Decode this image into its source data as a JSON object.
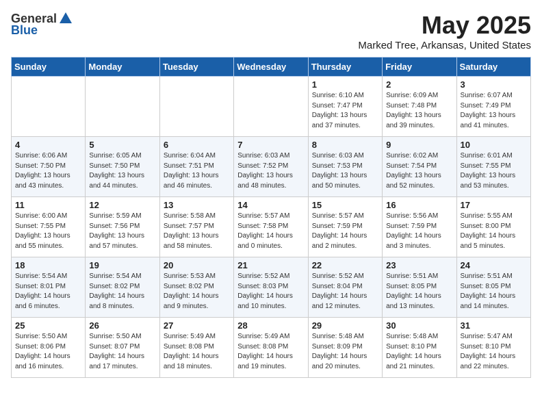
{
  "header": {
    "logo_general": "General",
    "logo_blue": "Blue",
    "month": "May 2025",
    "location": "Marked Tree, Arkansas, United States"
  },
  "weekdays": [
    "Sunday",
    "Monday",
    "Tuesday",
    "Wednesday",
    "Thursday",
    "Friday",
    "Saturday"
  ],
  "weeks": [
    [
      {
        "day": "",
        "info": ""
      },
      {
        "day": "",
        "info": ""
      },
      {
        "day": "",
        "info": ""
      },
      {
        "day": "",
        "info": ""
      },
      {
        "day": "1",
        "info": "Sunrise: 6:10 AM\nSunset: 7:47 PM\nDaylight: 13 hours\nand 37 minutes."
      },
      {
        "day": "2",
        "info": "Sunrise: 6:09 AM\nSunset: 7:48 PM\nDaylight: 13 hours\nand 39 minutes."
      },
      {
        "day": "3",
        "info": "Sunrise: 6:07 AM\nSunset: 7:49 PM\nDaylight: 13 hours\nand 41 minutes."
      }
    ],
    [
      {
        "day": "4",
        "info": "Sunrise: 6:06 AM\nSunset: 7:50 PM\nDaylight: 13 hours\nand 43 minutes."
      },
      {
        "day": "5",
        "info": "Sunrise: 6:05 AM\nSunset: 7:50 PM\nDaylight: 13 hours\nand 44 minutes."
      },
      {
        "day": "6",
        "info": "Sunrise: 6:04 AM\nSunset: 7:51 PM\nDaylight: 13 hours\nand 46 minutes."
      },
      {
        "day": "7",
        "info": "Sunrise: 6:03 AM\nSunset: 7:52 PM\nDaylight: 13 hours\nand 48 minutes."
      },
      {
        "day": "8",
        "info": "Sunrise: 6:03 AM\nSunset: 7:53 PM\nDaylight: 13 hours\nand 50 minutes."
      },
      {
        "day": "9",
        "info": "Sunrise: 6:02 AM\nSunset: 7:54 PM\nDaylight: 13 hours\nand 52 minutes."
      },
      {
        "day": "10",
        "info": "Sunrise: 6:01 AM\nSunset: 7:55 PM\nDaylight: 13 hours\nand 53 minutes."
      }
    ],
    [
      {
        "day": "11",
        "info": "Sunrise: 6:00 AM\nSunset: 7:55 PM\nDaylight: 13 hours\nand 55 minutes."
      },
      {
        "day": "12",
        "info": "Sunrise: 5:59 AM\nSunset: 7:56 PM\nDaylight: 13 hours\nand 57 minutes."
      },
      {
        "day": "13",
        "info": "Sunrise: 5:58 AM\nSunset: 7:57 PM\nDaylight: 13 hours\nand 58 minutes."
      },
      {
        "day": "14",
        "info": "Sunrise: 5:57 AM\nSunset: 7:58 PM\nDaylight: 14 hours\nand 0 minutes."
      },
      {
        "day": "15",
        "info": "Sunrise: 5:57 AM\nSunset: 7:59 PM\nDaylight: 14 hours\nand 2 minutes."
      },
      {
        "day": "16",
        "info": "Sunrise: 5:56 AM\nSunset: 7:59 PM\nDaylight: 14 hours\nand 3 minutes."
      },
      {
        "day": "17",
        "info": "Sunrise: 5:55 AM\nSunset: 8:00 PM\nDaylight: 14 hours\nand 5 minutes."
      }
    ],
    [
      {
        "day": "18",
        "info": "Sunrise: 5:54 AM\nSunset: 8:01 PM\nDaylight: 14 hours\nand 6 minutes."
      },
      {
        "day": "19",
        "info": "Sunrise: 5:54 AM\nSunset: 8:02 PM\nDaylight: 14 hours\nand 8 minutes."
      },
      {
        "day": "20",
        "info": "Sunrise: 5:53 AM\nSunset: 8:02 PM\nDaylight: 14 hours\nand 9 minutes."
      },
      {
        "day": "21",
        "info": "Sunrise: 5:52 AM\nSunset: 8:03 PM\nDaylight: 14 hours\nand 10 minutes."
      },
      {
        "day": "22",
        "info": "Sunrise: 5:52 AM\nSunset: 8:04 PM\nDaylight: 14 hours\nand 12 minutes."
      },
      {
        "day": "23",
        "info": "Sunrise: 5:51 AM\nSunset: 8:05 PM\nDaylight: 14 hours\nand 13 minutes."
      },
      {
        "day": "24",
        "info": "Sunrise: 5:51 AM\nSunset: 8:05 PM\nDaylight: 14 hours\nand 14 minutes."
      }
    ],
    [
      {
        "day": "25",
        "info": "Sunrise: 5:50 AM\nSunset: 8:06 PM\nDaylight: 14 hours\nand 16 minutes."
      },
      {
        "day": "26",
        "info": "Sunrise: 5:50 AM\nSunset: 8:07 PM\nDaylight: 14 hours\nand 17 minutes."
      },
      {
        "day": "27",
        "info": "Sunrise: 5:49 AM\nSunset: 8:08 PM\nDaylight: 14 hours\nand 18 minutes."
      },
      {
        "day": "28",
        "info": "Sunrise: 5:49 AM\nSunset: 8:08 PM\nDaylight: 14 hours\nand 19 minutes."
      },
      {
        "day": "29",
        "info": "Sunrise: 5:48 AM\nSunset: 8:09 PM\nDaylight: 14 hours\nand 20 minutes."
      },
      {
        "day": "30",
        "info": "Sunrise: 5:48 AM\nSunset: 8:10 PM\nDaylight: 14 hours\nand 21 minutes."
      },
      {
        "day": "31",
        "info": "Sunrise: 5:47 AM\nSunset: 8:10 PM\nDaylight: 14 hours\nand 22 minutes."
      }
    ]
  ]
}
